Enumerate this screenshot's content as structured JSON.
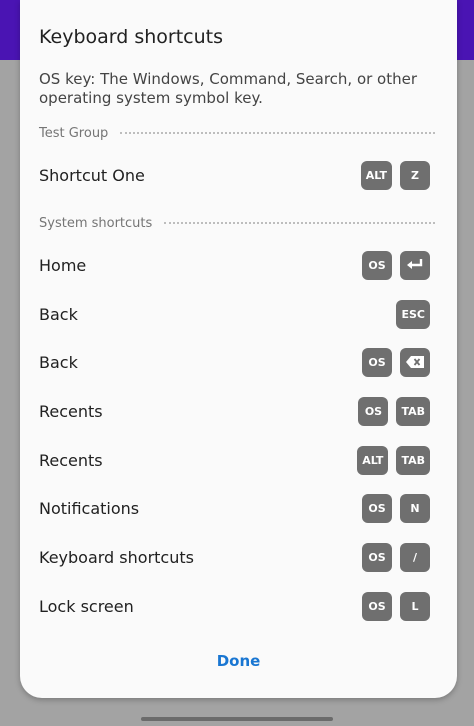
{
  "dialog": {
    "title": "Keyboard shortcuts",
    "os_note": "OS key: The Windows, Command, Search, or other operating system symbol key.",
    "done_label": "Done"
  },
  "groups": [
    {
      "name": "Test Group",
      "shortcuts": [
        {
          "label": "Shortcut One",
          "keys": [
            "ALT",
            "Z"
          ]
        }
      ]
    },
    {
      "name": "System shortcuts",
      "shortcuts": [
        {
          "label": "Home",
          "keys": [
            "OS",
            "enter-icon"
          ]
        },
        {
          "label": "Back",
          "keys": [
            "ESC"
          ]
        },
        {
          "label": "Back",
          "keys": [
            "OS",
            "backspace-icon"
          ]
        },
        {
          "label": "Recents",
          "keys": [
            "OS",
            "TAB"
          ]
        },
        {
          "label": "Recents",
          "keys": [
            "ALT",
            "TAB"
          ]
        },
        {
          "label": "Notifications",
          "keys": [
            "OS",
            "N"
          ]
        },
        {
          "label": "Keyboard shortcuts",
          "keys": [
            "OS",
            "/"
          ]
        },
        {
          "label": "Lock screen",
          "keys": [
            "OS",
            "L"
          ]
        }
      ]
    }
  ],
  "colors": {
    "app_bar": "#4a14b3",
    "key_bg": "#6f6f6f",
    "accent": "#1976d2"
  }
}
